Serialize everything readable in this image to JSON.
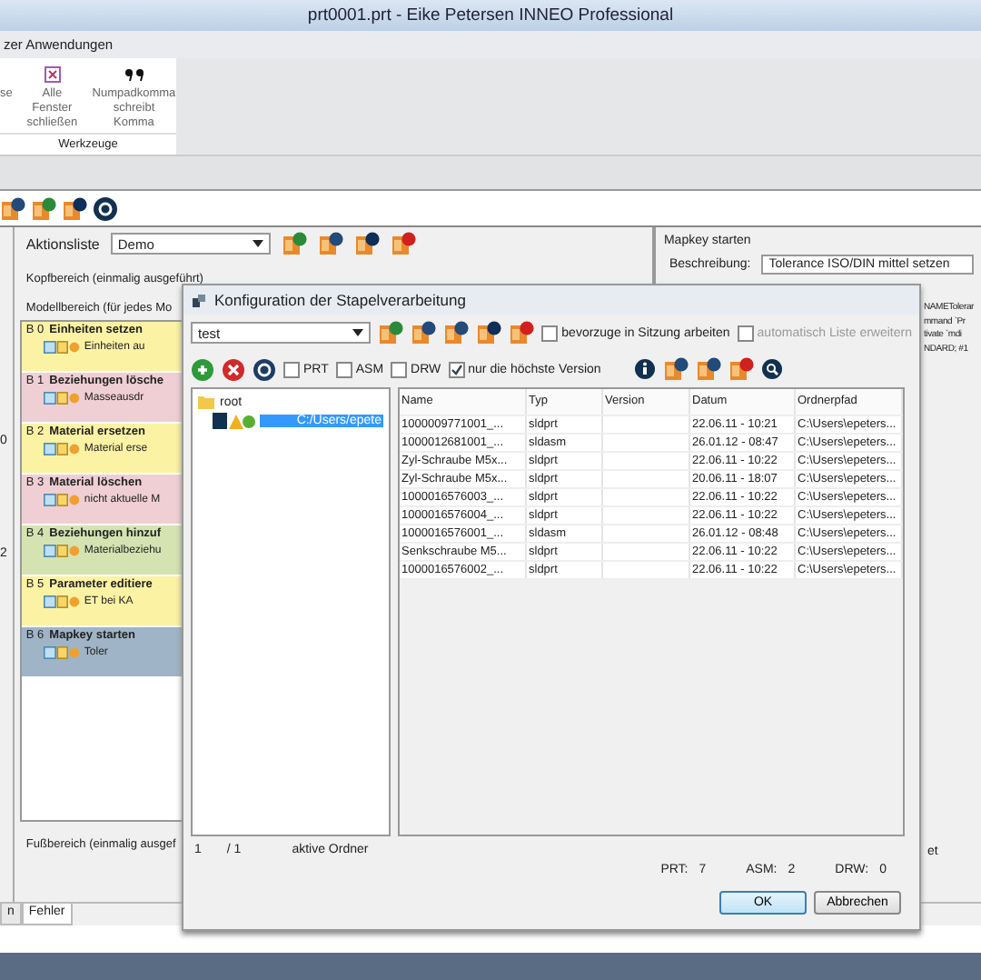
{
  "window": {
    "title": "prt0001.prt - Eike Petersen INNEO  Professional"
  },
  "menu": [
    "zer Anwendungen"
  ],
  "ribbon": {
    "buttons": [
      {
        "label": "se",
        "kind": "plain"
      },
      {
        "label": "Alle Fenster schließen",
        "kind": "close-all"
      },
      {
        "label": "Numpadkomma schreibt Komma",
        "kind": "comma"
      }
    ],
    "group": "Werkzeuge"
  },
  "side_strip": [
    "0",
    "2"
  ],
  "actions": {
    "label": "Aktionsliste",
    "value": "Demo",
    "header": "Kopfbereich (einmalig ausgeführt)",
    "model": "Modellbereich (für jedes Mo",
    "footer": "Fußbereich (einmalig ausgef",
    "items": [
      {
        "index": "B 0",
        "title": "Einheiten setzen",
        "text": "Einheiten au",
        "color": "#fbf2a4"
      },
      {
        "index": "B 1",
        "title": "Beziehungen lösche",
        "text": "Masseausdr",
        "color": "#efcfd4"
      },
      {
        "index": "B 2",
        "title": "Material ersetzen",
        "text": "Material erse",
        "color": "#fbf2a4"
      },
      {
        "index": "B 3",
        "title": "Material löschen",
        "text": "nicht aktuelle M",
        "color": "#efcfd4"
      },
      {
        "index": "B 4",
        "title": "Beziehungen hinzuf",
        "text": "Materialbeziehu",
        "color": "#d5e3b2"
      },
      {
        "index": "B 5",
        "title": "Parameter editiere",
        "text": "ET bei KA",
        "color": "#fbf2a4"
      },
      {
        "index": "B 6",
        "title": "Mapkey starten",
        "text": "Toler",
        "color": "#9fb4c6"
      }
    ]
  },
  "mapkey": {
    "title": "Mapkey starten",
    "label": "Beschreibung:",
    "value": "Tolerance ISO/DIN mittel setzen",
    "code": [
      "NAMETolerar",
      "mmand `Pr",
      "tivate `mdi",
      "NDARD; #1"
    ],
    "footer_text": "et"
  },
  "bottom_tabs": [
    {
      "label": "n",
      "selected": false
    },
    {
      "label": "Fehler",
      "selected": true
    }
  ],
  "dialog": {
    "title": "Konfiguration der Stapelverarbeitung",
    "combo": "test",
    "options": [
      {
        "label": "bevorzuge in Sitzung arbeiten",
        "checked": false,
        "disabled": false
      },
      {
        "label": "automatisch Liste erweitern",
        "checked": false,
        "disabled": true
      }
    ],
    "filters": [
      {
        "label": "PRT",
        "checked": false
      },
      {
        "label": "ASM",
        "checked": false
      },
      {
        "label": "DRW",
        "checked": false
      },
      {
        "label": "nur die höchste Version",
        "checked": true
      }
    ],
    "tree": {
      "label": "root",
      "children": [
        {
          "label": "C:/Users/epete",
          "selected": true
        }
      ]
    },
    "columns": [
      "Name",
      "Typ",
      "Version",
      "Datum",
      "Ordnerpfad"
    ],
    "rows": [
      {
        "name": "1000009771001_...",
        "type": "sldprt",
        "date": "22.06.11 - 10:21",
        "path": "C:\\Users\\epeters..."
      },
      {
        "name": "1000012681001_...",
        "type": "sldasm",
        "date": "26.01.12 - 08:47",
        "path": "C:\\Users\\epeters..."
      },
      {
        "name": "Zyl-Schraube M5x...",
        "type": "sldprt",
        "date": "22.06.11 - 10:22",
        "path": "C:\\Users\\epeters..."
      },
      {
        "name": "Zyl-Schraube M5x...",
        "type": "sldprt",
        "date": "20.06.11 - 18:07",
        "path": "C:\\Users\\epeters..."
      },
      {
        "name": "1000016576003_...",
        "type": "sldprt",
        "date": "22.06.11 - 10:22",
        "path": "C:\\Users\\epeters..."
      },
      {
        "name": "1000016576004_...",
        "type": "sldprt",
        "date": "22.06.11 - 10:22",
        "path": "C:\\Users\\epeters..."
      },
      {
        "name": "1000016576001_...",
        "type": "sldasm",
        "date": "26.01.12 - 08:48",
        "path": "C:\\Users\\epeters..."
      },
      {
        "name": "Senkschraube M5...",
        "type": "sldprt",
        "date": "22.06.11 - 10:22",
        "path": "C:\\Users\\epeters..."
      },
      {
        "name": "1000016576002_...",
        "type": "sldprt",
        "date": "22.06.11 - 10:22",
        "path": "C:\\Users\\epeters..."
      }
    ],
    "status": {
      "current": "1",
      "total": "/ 1",
      "label": "aktive Ordner"
    },
    "counts": [
      {
        "label": "PRT:",
        "value": "7"
      },
      {
        "label": "ASM:",
        "value": "2"
      },
      {
        "label": "DRW:",
        "value": "0"
      }
    ],
    "buttons": [
      {
        "label": "OK",
        "kind": "default"
      },
      {
        "label": "Abbrechen",
        "kind": "normal"
      }
    ]
  }
}
